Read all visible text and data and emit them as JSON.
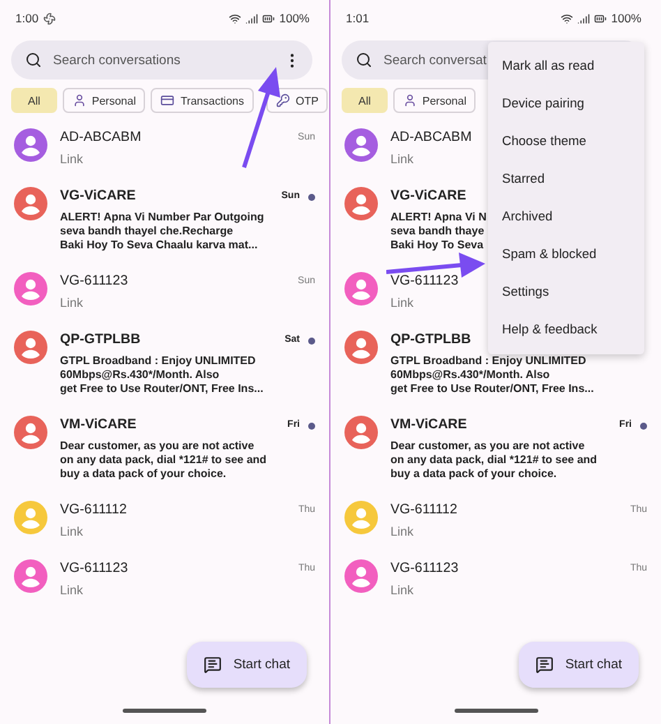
{
  "panels": [
    {
      "status_bar": {
        "time": "1:00",
        "battery": "100%",
        "fan_icon": true
      },
      "search": {
        "placeholder": "Search conversations"
      },
      "chips": [
        {
          "label": "All",
          "kind": "plain",
          "selected": true
        },
        {
          "label": "Personal",
          "kind": "person",
          "selected": false
        },
        {
          "label": "Transactions",
          "kind": "card",
          "selected": false
        },
        {
          "label": "OTP",
          "kind": "key",
          "selected": false
        }
      ],
      "conversations": [
        {
          "name": "AD-ABCABM",
          "unread": false,
          "color": "#a55ee0",
          "time": "Sun",
          "lines": [
            "Link"
          ]
        },
        {
          "name": "VG-ViCARE",
          "unread": true,
          "color": "#e8635a",
          "time": "Sun",
          "lines": [
            "ALERT! Apna Vi Number Par Outgoing",
            "seva bandh thayel che.Recharge",
            "Baki Hoy To Seva Chaalu karva mat..."
          ]
        },
        {
          "name": "VG-611123",
          "unread": false,
          "color": "#f25fbf",
          "time": "Sun",
          "lines": [
            "Link"
          ]
        },
        {
          "name": "QP-GTPLBB",
          "unread": true,
          "color": "#e8635a",
          "time": "Sat",
          "lines": [
            "GTPL Broadband : Enjoy UNLIMITED",
            "60Mbps@Rs.430*/Month. Also",
            "get Free to Use Router/ONT, Free Ins..."
          ]
        },
        {
          "name": "VM-ViCARE",
          "unread": true,
          "color": "#e8635a",
          "time": "Fri",
          "lines": [
            "Dear customer, as you are not active",
            "on any data pack, dial *121# to see and",
            "buy a data pack of your choice."
          ]
        },
        {
          "name": "VG-611112",
          "unread": false,
          "color": "#f6c83c",
          "time": "Thu",
          "lines": [
            "Link"
          ]
        },
        {
          "name": "VG-611123",
          "unread": false,
          "color": "#f25fbf",
          "time": "Thu",
          "lines": [
            "Link"
          ]
        }
      ],
      "fab": "Start chat"
    },
    {
      "status_bar": {
        "time": "1:01",
        "battery": "100%",
        "fan_icon": false
      },
      "search": {
        "placeholder": "Search conversat"
      },
      "chips": [
        {
          "label": "All",
          "kind": "plain",
          "selected": true
        },
        {
          "label": "Personal",
          "kind": "person",
          "selected": false
        }
      ],
      "conversations": [
        {
          "name": "AD-ABCABM",
          "unread": false,
          "color": "#a55ee0",
          "lines": [
            "Link"
          ]
        },
        {
          "name": "VG-ViCARE",
          "unread": true,
          "color": "#e8635a",
          "lines": [
            "ALERT! Apna Vi N",
            "seva bandh thaye",
            "Baki Hoy To Seva"
          ]
        },
        {
          "name": "VG-611123",
          "unread": false,
          "color": "#f25fbf",
          "lines": [
            "Link"
          ]
        },
        {
          "name": "QP-GTPLBB",
          "unread": true,
          "color": "#e8635a",
          "lines": [
            "GTPL Broadband : Enjoy UNLIMITED",
            "60Mbps@Rs.430*/Month. Also",
            "get Free to Use Router/ONT, Free Ins..."
          ]
        },
        {
          "name": "VM-ViCARE",
          "unread": true,
          "color": "#e8635a",
          "time": "Fri",
          "lines": [
            "Dear customer, as you are not active",
            "on any data pack, dial *121# to see and",
            "buy a data pack of your choice."
          ]
        },
        {
          "name": "VG-611112",
          "unread": false,
          "color": "#f6c83c",
          "time": "Thu",
          "lines": [
            "Link"
          ]
        },
        {
          "name": "VG-611123",
          "unread": false,
          "color": "#f25fbf",
          "time": "Thu",
          "lines": [
            "Link"
          ]
        }
      ],
      "fab": "Start chat",
      "menu": [
        "Mark all as read",
        "Device pairing",
        "Choose theme",
        "Starred",
        "Archived",
        "Spam & blocked",
        "Settings",
        "Help & feedback"
      ]
    }
  ]
}
